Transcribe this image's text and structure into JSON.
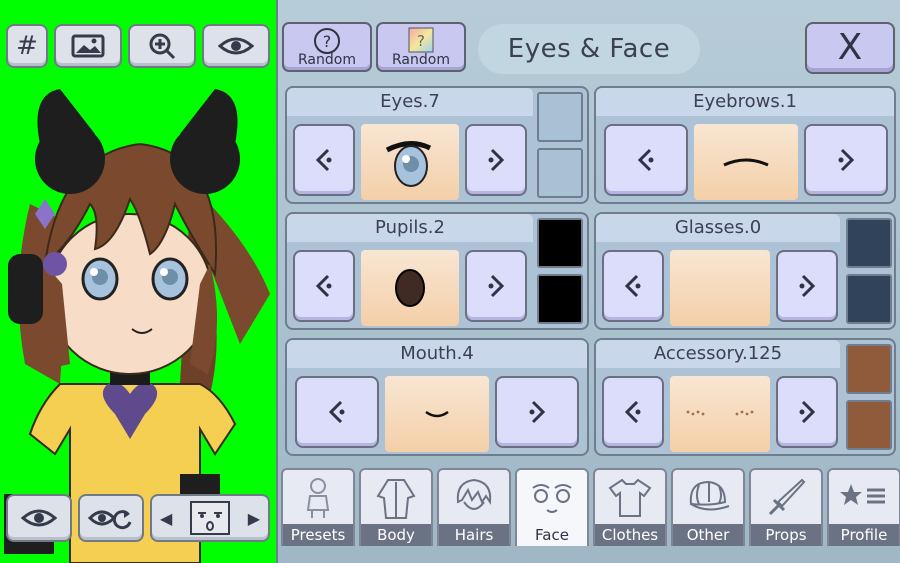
{
  "left_toolbar": {
    "grid_label": "#"
  },
  "header": {
    "random1_label": "Random",
    "random2_label": "Random",
    "title": "Eyes & Face",
    "close_label": "X"
  },
  "panels": {
    "eyes": {
      "label": "Eyes.7"
    },
    "eyebrows": {
      "label": "Eyebrows.1"
    },
    "pupils": {
      "label": "Pupils.2"
    },
    "glasses": {
      "label": "Glasses.0"
    },
    "mouth": {
      "label": "Mouth.4"
    },
    "accessory": {
      "label": "Accessory.125"
    }
  },
  "swatches": {
    "eyes": [
      "#a8c1d5",
      "#a8c1d5"
    ],
    "pupils": [
      "#000000",
      "#000000"
    ],
    "glasses": [
      "#31435b",
      "#31435b"
    ],
    "accessory": [
      "#8f5b3b",
      "#8f5b3b"
    ]
  },
  "tabs": [
    {
      "label": "Presets",
      "icon": "preset-icon"
    },
    {
      "label": "Body",
      "icon": "body-icon"
    },
    {
      "label": "Hairs",
      "icon": "hair-icon"
    },
    {
      "label": "Face",
      "icon": "face-icon"
    },
    {
      "label": "Clothes",
      "icon": "shirt-icon"
    },
    {
      "label": "Other",
      "icon": "cap-icon"
    },
    {
      "label": "Props",
      "icon": "sword-icon"
    },
    {
      "label": "Profile",
      "icon": "profile-icon"
    }
  ],
  "colors": {
    "background": "#00ff00",
    "accent": "#c9c8f0"
  }
}
